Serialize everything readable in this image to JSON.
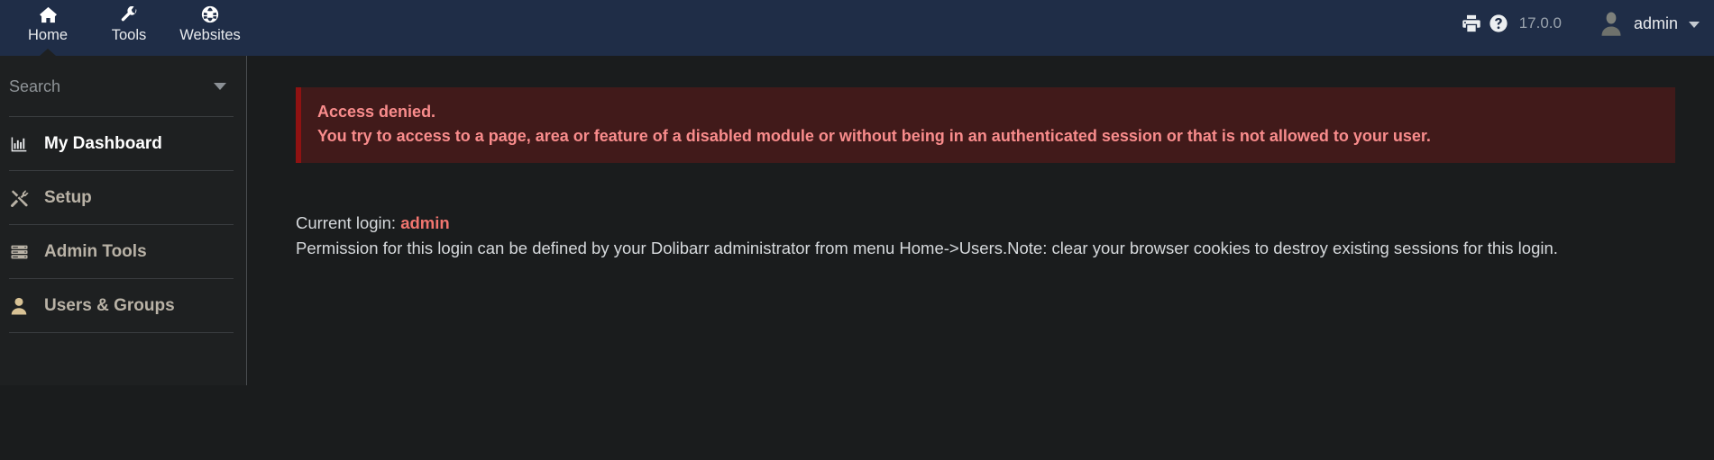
{
  "navbar": {
    "tabs": [
      {
        "label": "Home",
        "icon": "home-icon",
        "active": true
      },
      {
        "label": "Tools",
        "icon": "wrench-icon",
        "active": false
      },
      {
        "label": "Websites",
        "icon": "globe-icon",
        "active": false
      }
    ],
    "print_icon": "printer-icon",
    "help_icon": "help-circle-icon",
    "version": "17.0.0",
    "user": {
      "avatar_icon": "user-avatar-icon",
      "name": "admin",
      "dropdown_icon": "chevron-down-icon"
    },
    "background_color": "#1f2d47"
  },
  "sidebar": {
    "search": {
      "placeholder": "Search",
      "value": "",
      "dropdown_icon": "caret-down-icon"
    },
    "items": [
      {
        "label": "My Dashboard",
        "icon": "chart-bar-icon",
        "state": "active"
      },
      {
        "label": "Setup",
        "icon": "tools-cross-icon",
        "state": "normal"
      },
      {
        "label": "Admin Tools",
        "icon": "server-rack-icon",
        "state": "normal"
      },
      {
        "label": "Users & Groups",
        "icon": "user-icon",
        "state": "accent"
      }
    ],
    "background_color": "#1e2021"
  },
  "main": {
    "alert": {
      "title": "Access denied.",
      "message": "You try to access to a page, area or feature of a disabled module or without being in an authenticated session or that is not allowed to your user.",
      "background_color": "#411a1a",
      "border_color": "#8f1212",
      "text_color": "#f98c8c"
    },
    "info": {
      "current_login_label": "Current login:",
      "current_login_value": "admin",
      "permission_note": "Permission for this login can be defined by your Dolibarr administrator from menu Home->Users.Note: clear your browser cookies to destroy existing sessions for this login."
    }
  }
}
